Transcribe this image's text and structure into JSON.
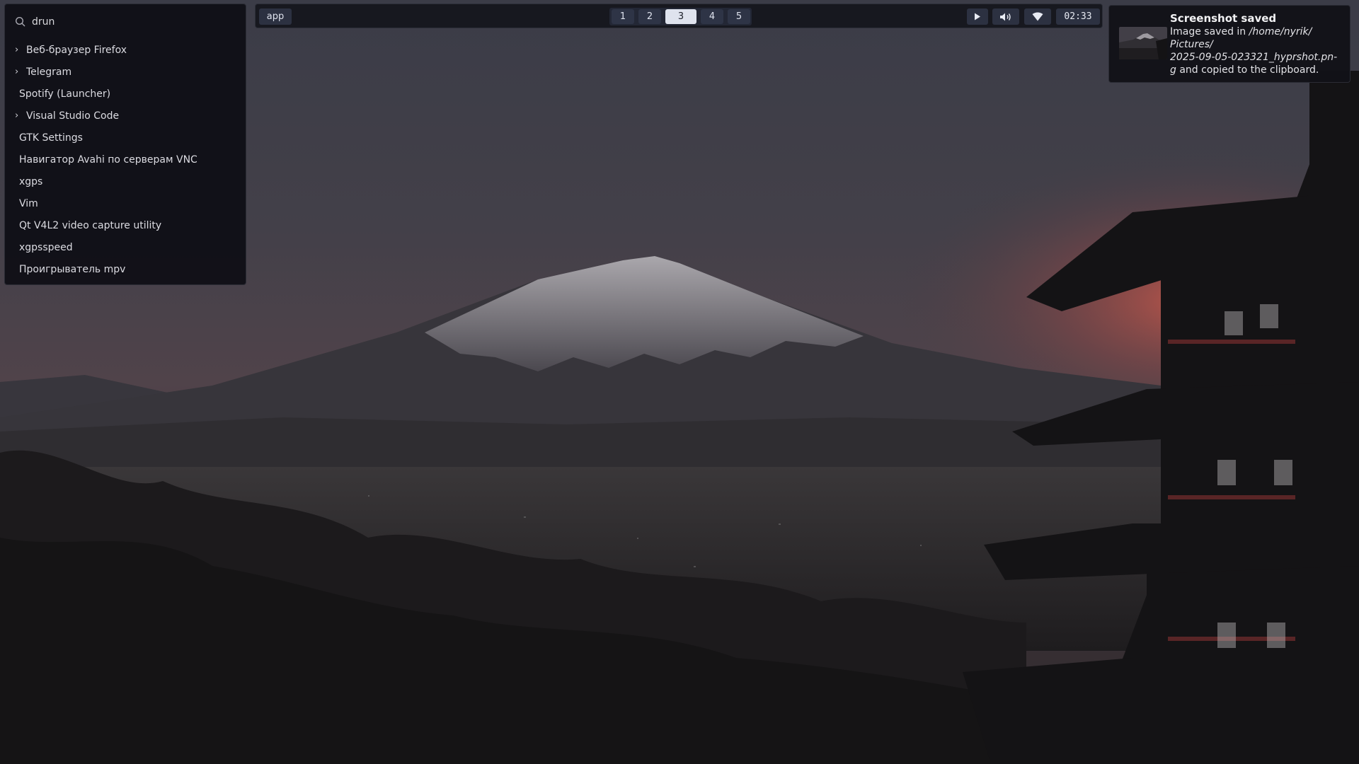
{
  "launcher": {
    "mode": "drun",
    "items": [
      {
        "label": "Веб-браузер Firefox",
        "expandable": true
      },
      {
        "label": "Telegram",
        "expandable": true
      },
      {
        "label": "Spotify (Launcher)",
        "expandable": false
      },
      {
        "label": "Visual Studio Code",
        "expandable": true
      },
      {
        "label": "GTK Settings",
        "expandable": false
      },
      {
        "label": "Навигатор Avahi по серверам VNC",
        "expandable": false
      },
      {
        "label": "xgps",
        "expandable": false
      },
      {
        "label": "Vim",
        "expandable": false
      },
      {
        "label": "Qt V4L2 video capture utility",
        "expandable": false
      },
      {
        "label": "xgpsspeed",
        "expandable": false
      },
      {
        "label": "Проигрыватель mpv",
        "expandable": false
      }
    ]
  },
  "topbar": {
    "app_label": "app",
    "workspaces": [
      "1",
      "2",
      "3",
      "4",
      "5"
    ],
    "active_workspace": "3",
    "tray": {
      "media_icon": "play-icon",
      "volume_icon": "volume-icon",
      "network_icon": "wifi-icon",
      "clock": "02:33"
    }
  },
  "notification": {
    "title": "Screenshot saved",
    "body_prefix": "Image saved in ",
    "path_line1": "/home/nyrik/",
    "path_line2": "Pictures/",
    "path_line3": "2025-09-05-023321_hyprshot.pn-",
    "path_line4": "g",
    "body_suffix": " and copied to the clipboard."
  },
  "colors": {
    "bar_bg": "#14151c",
    "pill_bg": "#2c3141",
    "active_ws": "#dfe3ee",
    "sunset": "#c0584a"
  }
}
